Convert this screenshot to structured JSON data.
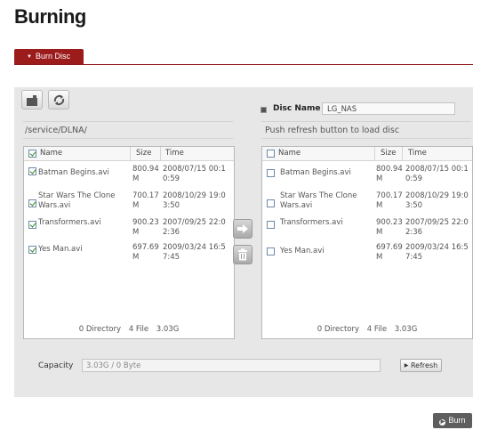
{
  "page": {
    "title": "Burning"
  },
  "tab": {
    "label": "Burn Disc"
  },
  "left": {
    "path": "/service/DLNA/",
    "headers": {
      "name": "Name",
      "size": "Size",
      "time": "Time"
    },
    "files": [
      {
        "name": "Batman Begins.avi",
        "size": "800.94 M",
        "time": "2008/07/15 00:1\n0:59",
        "checked": true
      },
      {
        "name": "Star Wars The Clone Wars.avi",
        "size": "700.17 M",
        "time": "2008/10/29 19:0\n3:50",
        "checked": true
      },
      {
        "name": "Transformers.avi",
        "size": "900.23 M",
        "time": "2007/09/25 22:0\n2:36",
        "checked": true
      },
      {
        "name": "Yes Man.avi",
        "size": "697.69 M",
        "time": "2009/03/24 16:5\n7:45",
        "checked": true
      }
    ],
    "summary": {
      "dirs": "0 Directory",
      "files": "4 File",
      "size": "3.03G"
    }
  },
  "right": {
    "disc_name_label": "Disc Name",
    "disc_name_value": "LG_NAS",
    "hint": "Push refresh button to load disc",
    "headers": {
      "name": "Name",
      "size": "Size",
      "time": "Time"
    },
    "files": [
      {
        "name": "Batman Begins.avi",
        "size": "800.94 M",
        "time": "2008/07/15 00:1\n0:59",
        "checked": false
      },
      {
        "name": "Star Wars The Clone Wars.avi",
        "size": "700.17 M",
        "time": "2008/10/29 19:0\n3:50",
        "checked": false
      },
      {
        "name": "Transformers.avi",
        "size": "900.23 M",
        "time": "2007/09/25 22:0\n2:36",
        "checked": false
      },
      {
        "name": "Yes Man.avi",
        "size": "697.69 M",
        "time": "2009/03/24 16:5\n7:45",
        "checked": false
      }
    ],
    "summary": {
      "dirs": "0 Directory",
      "files": "4 File",
      "size": "3.03G"
    }
  },
  "capacity": {
    "label": "Capacity",
    "value": "3.03G / 0 Byte"
  },
  "buttons": {
    "refresh": "Refresh",
    "burn": "Burn"
  },
  "icons": {
    "up": "folder-up-icon",
    "refresh": "refresh-icon",
    "move": "arrow-right-icon",
    "delete": "trash-icon"
  },
  "colors": {
    "accent": "#9c1c1c",
    "panel": "#e7e7e7",
    "burn_button": "#5e5e5e"
  }
}
